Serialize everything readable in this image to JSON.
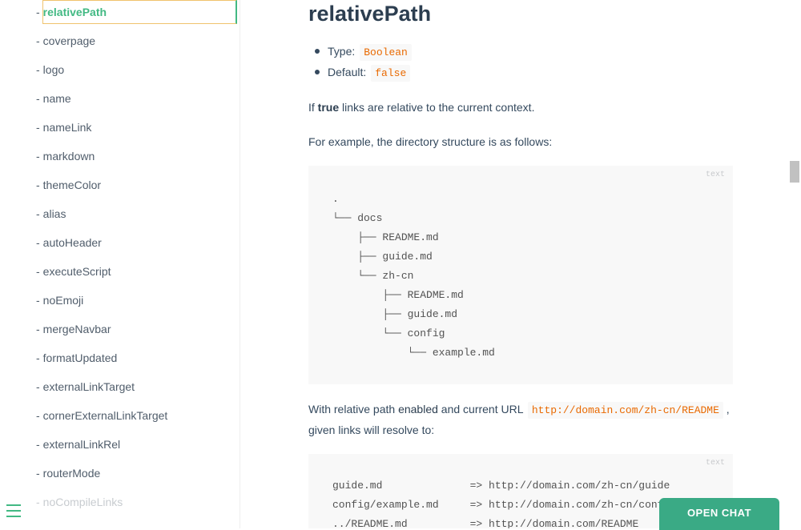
{
  "sidebar": {
    "items": [
      {
        "label": "relativePath",
        "active": true
      },
      {
        "label": "coverpage"
      },
      {
        "label": "logo"
      },
      {
        "label": "name"
      },
      {
        "label": "nameLink"
      },
      {
        "label": "markdown"
      },
      {
        "label": "themeColor"
      },
      {
        "label": "alias"
      },
      {
        "label": "autoHeader"
      },
      {
        "label": "executeScript"
      },
      {
        "label": "noEmoji"
      },
      {
        "label": "mergeNavbar"
      },
      {
        "label": "formatUpdated"
      },
      {
        "label": "externalLinkTarget"
      },
      {
        "label": "cornerExternalLinkTarget"
      },
      {
        "label": "externalLinkRel"
      },
      {
        "label": "routerMode"
      },
      {
        "label": "noCompileLinks"
      }
    ],
    "dash": "-",
    "toggle_icon": "menu-icon",
    "accent_color": "#42b983"
  },
  "main": {
    "title": "relativePath",
    "type_label": "Type:",
    "type_value": "Boolean",
    "default_label": "Default:",
    "default_value": "false",
    "para1_pre": "If ",
    "para1_bold": "true",
    "para1_post": " links are relative to the current context.",
    "para2": "For example, the directory structure is as follows:",
    "code1_lang": "text",
    "code1": ".\n└── docs\n    ├── README.md\n    ├── guide.md\n    └── zh-cn\n        ├── README.md\n        ├── guide.md\n        └── config\n            └── example.md",
    "para3_pre": "With relative path ",
    "para3_bold": "enabled",
    "para3_mid": " and current URL ",
    "para3_code": "http://domain.com/zh-cn/README",
    "para3_post": " ,",
    "para3_line2": "given links will resolve to:",
    "code2_lang": "text",
    "code2": "guide.md              => http://domain.com/zh-cn/guide\nconfig/example.md     => http://domain.com/zh-cn/config/example\n../README.md          => http://domain.com/README"
  },
  "chat": {
    "label": "OPEN CHAT",
    "color": "#3aaa85"
  }
}
